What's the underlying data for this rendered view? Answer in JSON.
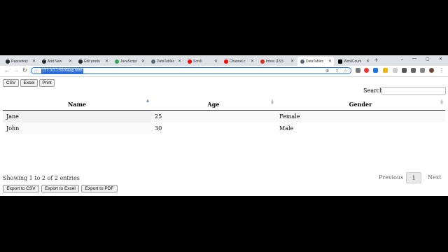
{
  "browser": {
    "tabs": [
      {
        "label": "Repository",
        "color": "#24292f"
      },
      {
        "label": "Add New",
        "color": "#24292f"
      },
      {
        "label": "Edit produ",
        "color": "#24292f"
      },
      {
        "label": "JavaScript",
        "color": "#3aa757"
      },
      {
        "label": "DataTables",
        "color": "#5a6b7b"
      },
      {
        "label": "Scroll",
        "color": "#ff0000"
      },
      {
        "label": "Channel c",
        "color": "#ff0000"
      },
      {
        "label": "Inbox (15,5",
        "color": "#d93025"
      },
      {
        "label": "DataTables",
        "color": "#5a6b7b"
      },
      {
        "label": "WordCount",
        "color": "#000000"
      }
    ],
    "url": "127.0.0.1:5500/jqg.html"
  },
  "toolbar_buttons": {
    "csv": "CSV",
    "excel": "Excel",
    "print": "Print"
  },
  "search": {
    "label": "Search:",
    "value": ""
  },
  "table": {
    "columns": [
      "Name",
      "Age",
      "Gender"
    ],
    "rows": [
      [
        "Jane",
        "25",
        "Female"
      ],
      [
        "John",
        "30",
        "Male"
      ]
    ]
  },
  "info": "Showing 1 to 2 of 2 entries",
  "pagination": {
    "previous": "Previous",
    "current": "1",
    "next": "Next"
  },
  "export_buttons": {
    "csv": "Export to CSV",
    "excel": "Export to Excel",
    "pdf": "Export to PDF"
  }
}
